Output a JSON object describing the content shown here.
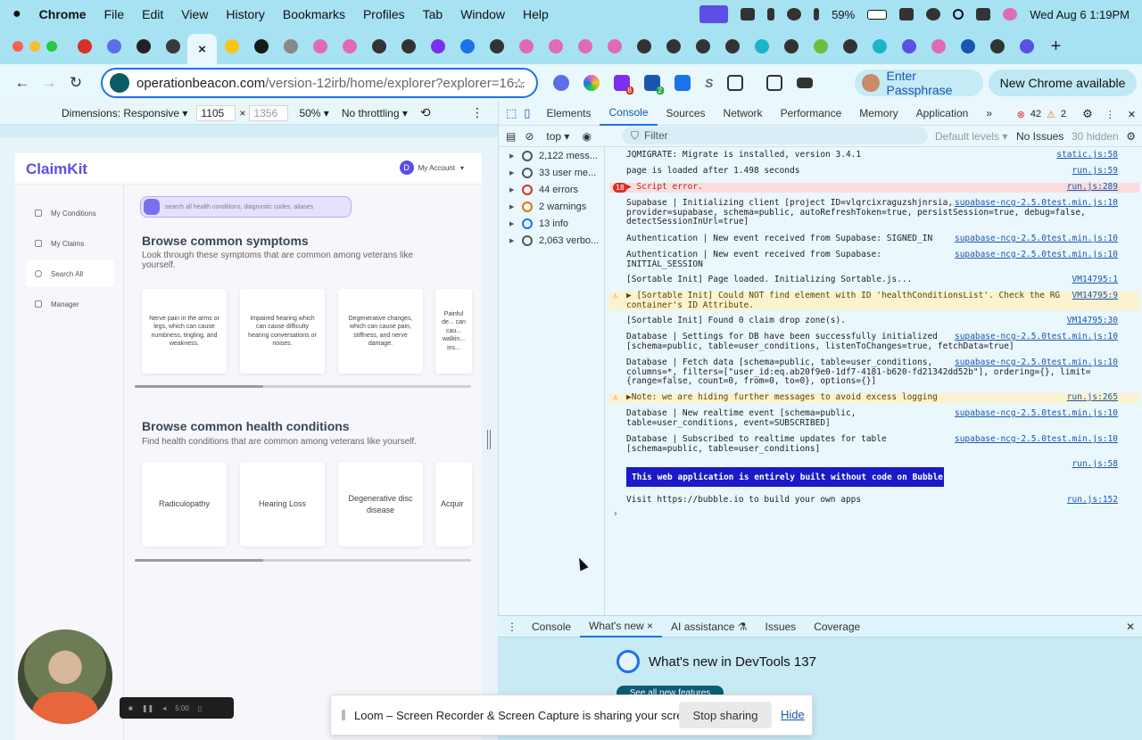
{
  "menubar": {
    "app": "Chrome",
    "items": [
      "File",
      "Edit",
      "View",
      "History",
      "Bookmarks",
      "Profiles",
      "Tab",
      "Window",
      "Help"
    ],
    "battery": "59%",
    "datetime": "Wed Aug 6  1:19PM"
  },
  "tabs": {
    "favicon_colors": [
      "#d93025",
      "#5b6fe6",
      "#222",
      "#3a3a3a",
      "#111",
      "#f5c518",
      "#1a1a1a",
      "#888",
      "#e06ab8",
      "#e06ab8",
      "#333",
      "#333",
      "#7b2ff0",
      "#1a73e8",
      "#333",
      "#e06ab8",
      "#e06ab8",
      "#e06ab8",
      "#e06ab8",
      "#333",
      "#333",
      "#333",
      "#333",
      "#1ab5c8",
      "#333",
      "#6bbf3a",
      "#333",
      "#1ab5c8",
      "#5b4fe6",
      "#e06ab8",
      "#1a56b0",
      "#333",
      "#5b4fe6"
    ],
    "active_close": "×",
    "new_tab": "+"
  },
  "toolbar": {
    "url_domain": "operationbeacon.com",
    "url_path": "/version-12irb/home/explorer?explorer=16...",
    "passphrase_label": "Enter Passphrase",
    "update_label": "New Chrome available",
    "ext_badge_1": "8",
    "ext_badge_2": "2"
  },
  "device_bar": {
    "dimensions_label": "Dimensions: Responsive ▾",
    "width": "1105",
    "times": "×",
    "height": "1356",
    "zoom": "50% ▾",
    "throttle": "No throttling ▾"
  },
  "app": {
    "logo": "ClaimKit",
    "account_initial": "D",
    "account_label": "My Account",
    "sidebar": [
      "My Conditions",
      "My Claims",
      "Search All",
      "Manager"
    ],
    "search_placeholder": "search all health conditions, diagnostic codes, aliases",
    "symptoms_title": "Browse common symptoms",
    "symptoms_sub": "Look through these symptoms that are common among veterans like yourself.",
    "symptom_cards": [
      "Nerve pain in the arms or legs, which can cause numbness, tingling, and weakness.",
      "Impaired hearing which can cause difficulty hearing conversations or noises.",
      "Degenerative changes, which can cause pain, stiffness, and nerve damage.",
      "Painful de... can cau... walkin... ins..."
    ],
    "conditions_title": "Browse common health conditions",
    "conditions_sub": "Find health conditions that are common among veterans like yourself.",
    "condition_cards": [
      "Radiculopathy",
      "Hearing Loss",
      "Degenerative disc disease",
      "Acquir"
    ]
  },
  "devtools": {
    "tabs": [
      "Elements",
      "Console",
      "Sources",
      "Network",
      "Performance",
      "Memory",
      "Application",
      "»"
    ],
    "active_tab": "Console",
    "error_count": "42",
    "warning_count": "2",
    "context": "top ▾",
    "filter_placeholder": "Filter",
    "levels": "Default levels ▾",
    "issues": "No Issues",
    "hidden": "30 hidden",
    "sidebar": [
      {
        "label": "2,122 mess...",
        "color": "#555"
      },
      {
        "label": "33 user me...",
        "color": "#555"
      },
      {
        "label": "44 errors",
        "color": "#d93025"
      },
      {
        "label": "2 warnings",
        "color": "#e37400"
      },
      {
        "label": "13 info",
        "color": "#1a73e8"
      },
      {
        "label": "2,063 verbo...",
        "color": "#555"
      }
    ],
    "logs": [
      {
        "text": "JQMIGRATE: Migrate is installed, version 3.4.1",
        "src": "static.js:58"
      },
      {
        "text": "page is loaded after 1.498 seconds",
        "src": "run.js:59"
      },
      {
        "text": "▶ Script error.",
        "src": "run.js:289",
        "badge": "18"
      },
      {
        "text": "Supabase | Initializing client [project ID=vlqrcixraguzshjnrsia,\nprovider=supabase, schema=public, autoRefreshToken=true, persistSession=true, debug=false,\ndetectSessionInUrl=true]",
        "src": "supabase-ncg-2.5.0test.min.js:10"
      },
      {
        "text": "Authentication | New event received from Supabase: SIGNED_IN",
        "src": "supabase-ncg-2.5.0test.min.js:10"
      },
      {
        "text": "Authentication | New event received from Supabase:\nINITIAL_SESSION",
        "src": "supabase-ncg-2.5.0test.min.js:10"
      },
      {
        "text": "[Sortable Init] Page loaded. Initializing Sortable.js...",
        "src": "VM14795:1"
      },
      {
        "text": "▶ [Sortable Init] Could NOT find element with ID 'healthConditionsList'. Check the RG\ncontainer's ID Attribute.",
        "src": "VM14795:9"
      },
      {
        "text": "[Sortable Init] Found 0 claim drop zone(s).",
        "src": "VM14795:30"
      },
      {
        "text": "Database | Settings for DB have been successfully initialized\n[schema=public, table=user_conditions, listenToChanges=true, fetchData=true]",
        "src": "supabase-ncg-2.5.0test.min.js:10"
      },
      {
        "text": "Database | Fetch data [schema=public, table=user_conditions,\ncolumns=*, filters=[\"user_id:eq.ab20f9e0-1df7-4181-b620-fd21342dd52b\"], ordering={}, limit=\n{range=false, count=0, from=0, to=0}, options={}]",
        "src": "supabase-ncg-2.5.0test.min.js:10"
      },
      {
        "text": "▶Note: we are hiding further messages to avoid excess logging",
        "src": "run.js:265"
      },
      {
        "text": "Database | New realtime event [schema=public,\ntable=user_conditions, event=SUBSCRIBED]",
        "src": "supabase-ncg-2.5.0test.min.js:10"
      },
      {
        "text": "Database | Subscribed to realtime updates for table\n[schema=public, table=user_conditions]",
        "src": "supabase-ncg-2.5.0test.min.js:10"
      },
      {
        "text": "",
        "src": "run.js:58"
      },
      {
        "text": "Visit https://bubble.io to build your own apps",
        "src": "run.js:152"
      }
    ],
    "bubble_banner": "This web application is entirely built without code on Bubble",
    "prompt": "›"
  },
  "drawer": {
    "tabs": [
      "Console",
      "What's new ×",
      "AI assistance ⚗",
      "Issues",
      "Coverage"
    ],
    "whatsnew_title": "What's new in DevTools 137",
    "see_all": "See all new features"
  },
  "loom": {
    "message": "Loom – Screen Recorder & Screen Capture is sharing your screen.",
    "stop": "Stop sharing",
    "hide": "Hide"
  },
  "camera": {
    "timer": "5:00"
  }
}
